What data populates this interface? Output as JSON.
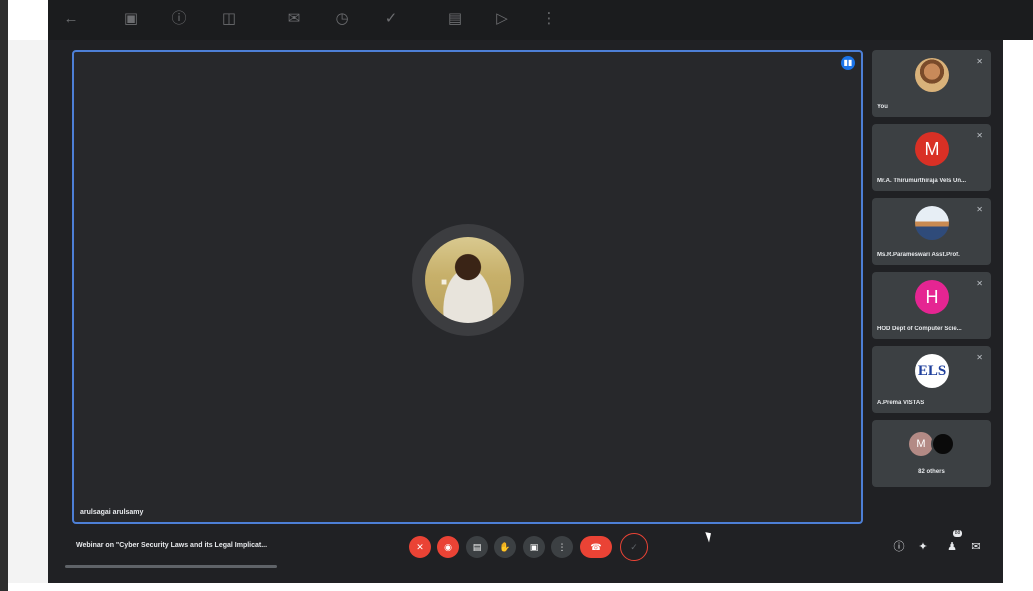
{
  "top_toolbar": {
    "icons": [
      "back-arrow-icon",
      "archive-icon",
      "report-icon",
      "delete-icon",
      "mail-icon",
      "snooze-icon",
      "add-task-icon",
      "move-to-icon",
      "label-icon",
      "more-vert-icon"
    ]
  },
  "stage": {
    "speaker_name": "arulsagai arulsamy",
    "speaking_indicator": "speaking-icon"
  },
  "participants": [
    {
      "name": "You",
      "avatar_type": "photo"
    },
    {
      "name": "Mr.A. Thirumurthiraja Vels Un...",
      "initial": "M",
      "color": "#d93025"
    },
    {
      "name": "Ms.R.Parameswari Asst.Prof.",
      "avatar_type": "photo"
    },
    {
      "name": "HOD Dept of Computer Scie...",
      "initial": "H",
      "color": "#e52592"
    },
    {
      "name": "A.Prema VISTAS",
      "logo_text": "ELS"
    }
  ],
  "others": {
    "initial": "M",
    "label": "82 others"
  },
  "bottom_bar": {
    "meeting_title": "Webinar on \"Cyber Security Laws and its Legal Implicat...",
    "participants_badge": "88"
  },
  "colors": {
    "background": "#202124",
    "tile": "#3c4043",
    "stage_border": "#4d7fd6",
    "danger": "#ea4335"
  }
}
